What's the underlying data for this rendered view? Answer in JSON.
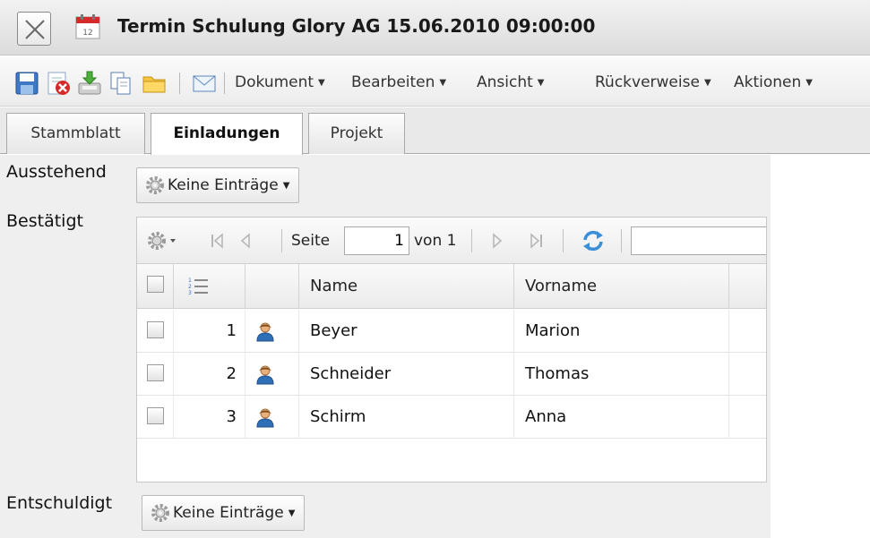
{
  "window": {
    "title": "Termin Schulung Glory AG 15.06.2010 09:00:00"
  },
  "toolbar": {
    "icons": [
      "save-icon",
      "delete-icon",
      "import-icon",
      "copy-icon",
      "folder-icon",
      "mail-icon"
    ],
    "menus": [
      "Dokument",
      "Bearbeiten",
      "Ansicht",
      "Rückverweise",
      "Aktionen"
    ]
  },
  "tabs": [
    {
      "label": "Stammblatt",
      "active": false
    },
    {
      "label": "Einladungen",
      "active": true
    },
    {
      "label": "Projekt",
      "active": false
    }
  ],
  "sections": {
    "ausstehend": {
      "label": "Ausstehend",
      "dropdown": "Keine Einträge"
    },
    "bestaetigt": {
      "label": "Bestätigt"
    },
    "entschuldigt": {
      "label": "Entschuldigt",
      "dropdown": "Keine Einträge"
    }
  },
  "grid": {
    "pager": {
      "page_label": "Seite",
      "page_value": "1",
      "of_label": "von 1",
      "search_value": ""
    },
    "columns": {
      "name": "Name",
      "vorname": "Vorname"
    },
    "rows": [
      {
        "num": "1",
        "name": "Beyer",
        "vorname": "Marion"
      },
      {
        "num": "2",
        "name": "Schneider",
        "vorname": "Thomas"
      },
      {
        "num": "3",
        "name": "Schirm",
        "vorname": "Anna"
      }
    ]
  },
  "colors": {
    "accent_red": "#d42a2a",
    "refresh_blue": "#3b8fd8",
    "person_blue": "#2f6fb5"
  }
}
